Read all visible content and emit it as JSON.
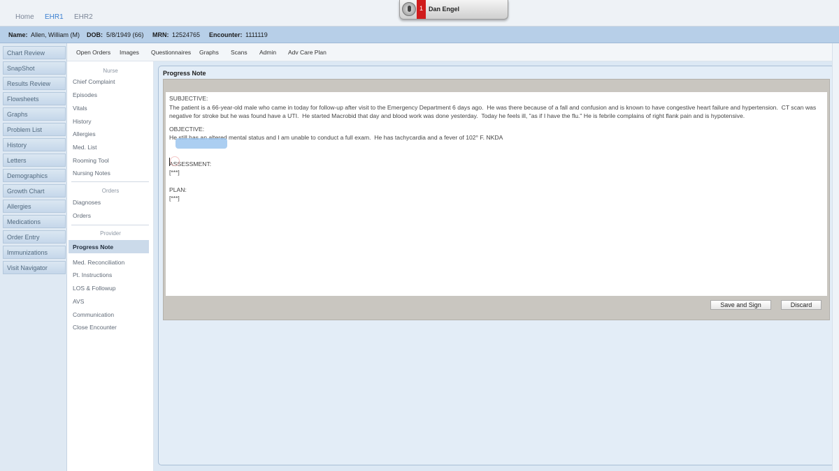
{
  "topnav": {
    "tabs": [
      {
        "label": "Home",
        "active": false
      },
      {
        "label": "EHR1",
        "active": true
      },
      {
        "label": "EHR2",
        "active": false
      }
    ],
    "user": {
      "name": "Dan Engel",
      "notification_count": "1"
    }
  },
  "patient": {
    "name_label": "Name:",
    "name": "Allen, William (M)",
    "dob_label": "DOB:",
    "dob": "5/8/1949 (66)",
    "mrn_label": "MRN:",
    "mrn": "12524765",
    "encounter_label": "Encounter:",
    "encounter": "1111119"
  },
  "leftnav": [
    "Chart Review",
    "SnapShot",
    "Results Review",
    "Flowsheets",
    "Graphs",
    "Problem List",
    "History",
    "Letters",
    "Demographics",
    "Growth Chart",
    "Allergies",
    "Medications",
    "Order Entry",
    "Immunizations",
    "Visit Navigator"
  ],
  "subnav": [
    "Open Orders",
    "Images",
    "Questionnaires",
    "Graphs",
    "Scans",
    "Admin",
    "Adv Care Plan"
  ],
  "activity": {
    "nurse_header": "Nurse",
    "nurse": [
      "Chief Complaint",
      "Episodes",
      "Vitals",
      "History",
      "Allergies",
      "Med. List",
      "Rooming Tool",
      "Nursing Notes"
    ],
    "orders_header": "Orders",
    "orders": [
      "Diagnoses",
      "Orders"
    ],
    "provider_header": "Provider",
    "provider": [
      "Progress Note",
      "Med. Reconciliation",
      "Pt. Instructions",
      "LOS & Followup",
      "AVS",
      "Communication",
      "Close Encounter"
    ]
  },
  "note": {
    "title": "Progress Note",
    "subjective_label": "SUBJECTIVE:",
    "subjective_text": "The patient is a 66-year-old male who came in today for follow-up after visit to the Emergency Department 6 days ago.  He was there because of a fall and confusion and is known to have congestive heart failure and hypertension.  CT scan was negative for stroke but he was found have a UTI.  He started Macrobid that day and blood work was done yesterday.  Today he feels ill, \"as if I have the flu.\" He is febrile complains of right flank pain and is hypotensive.",
    "objective_label": "OBJECTIVE:",
    "objective_text": "He still has an altered mental status and I am unable to conduct a full exam.  He has tachycardia and a fever of 102° F. NKDA",
    "assessment_label": "ASSESSMENT:",
    "assessment_text": "[***]",
    "plan_label": "PLAN:",
    "plan_text": "[***]",
    "save_label": "Save and Sign",
    "discard_label": "Discard"
  }
}
